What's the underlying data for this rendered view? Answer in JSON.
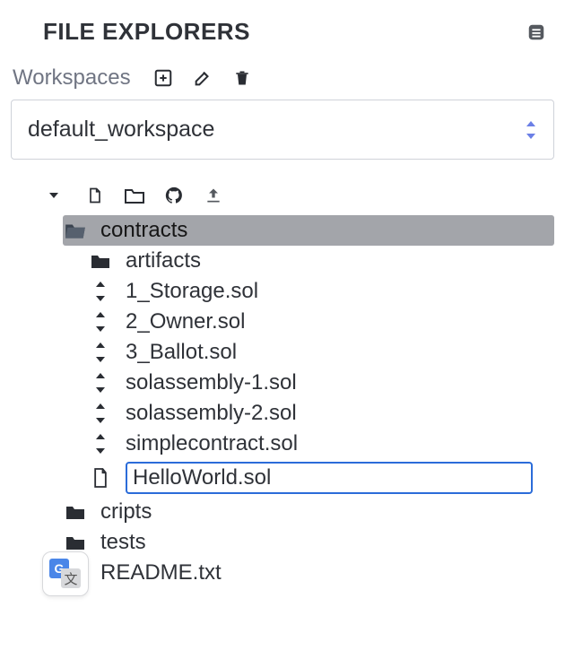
{
  "panelTitle": "FILE EXPLORERS",
  "workspacesLabel": "Workspaces",
  "selectedWorkspace": "default_workspace",
  "tree": {
    "contracts": "contracts",
    "artifacts": "artifacts",
    "storage": "1_Storage.sol",
    "owner": "2_Owner.sol",
    "ballot": "3_Ballot.sol",
    "solasm1": "solassembly-1.sol",
    "solasm2": "solassembly-2.sol",
    "simple": "simplecontract.sol",
    "editing": "HelloWorld.sol",
    "scripts": "cripts",
    "tests": "tests",
    "readme": "README.txt"
  }
}
